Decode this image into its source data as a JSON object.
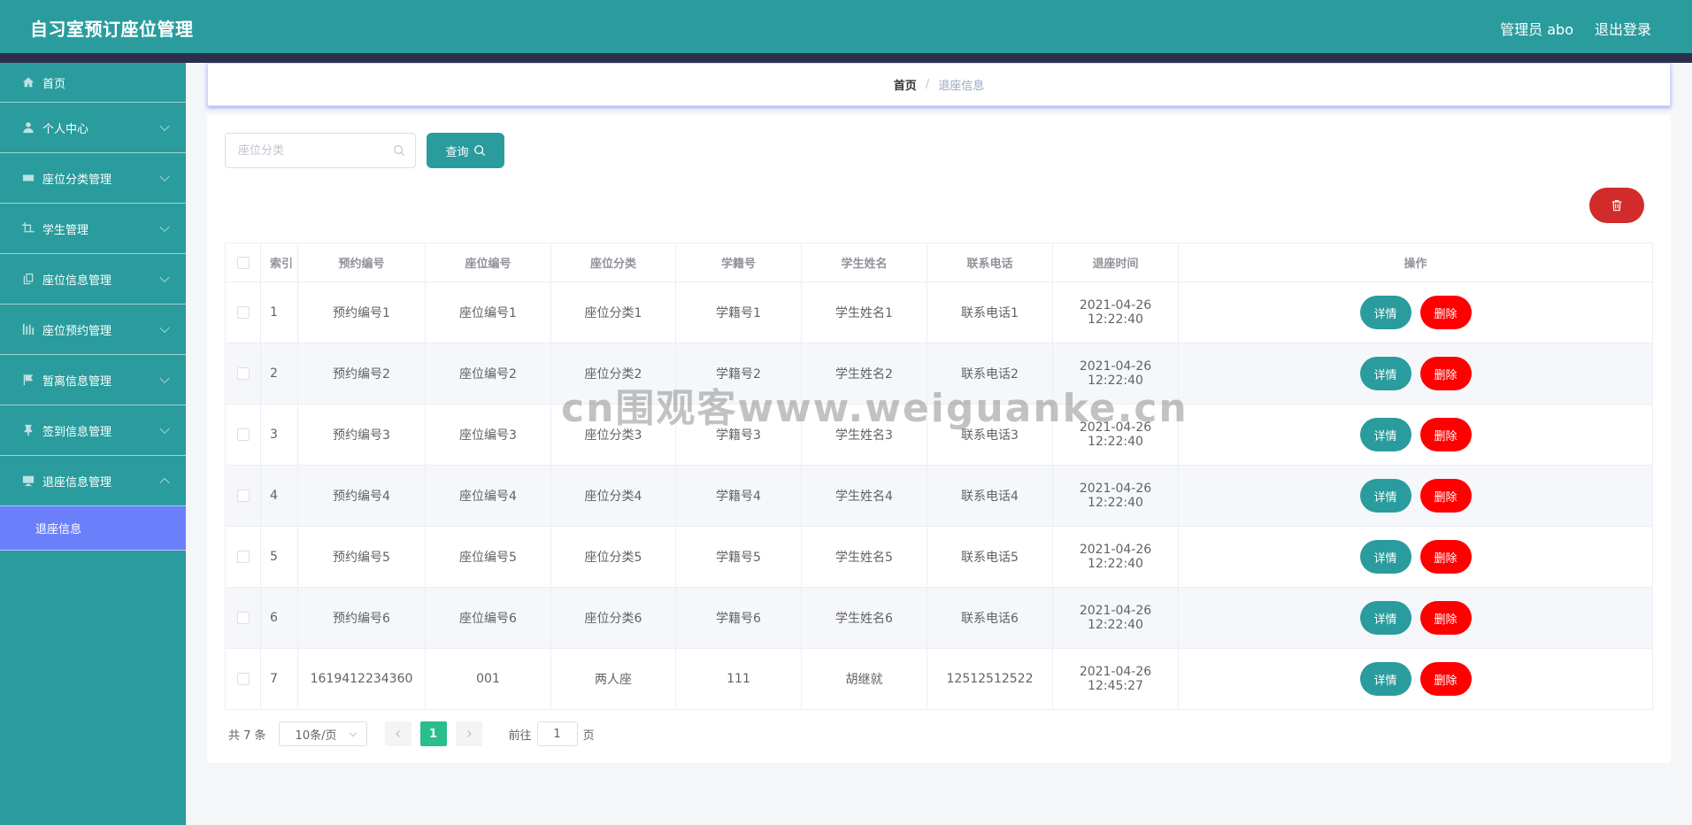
{
  "header": {
    "app_title": "自习室预订座位管理",
    "admin_label": "管理员 abo",
    "logout_label": "退出登录",
    "color": "#2a9c9d"
  },
  "sidebar": {
    "items": [
      {
        "label": "首页",
        "icon": "home-icon"
      },
      {
        "label": "个人中心",
        "icon": "user-icon"
      },
      {
        "label": "座位分类管理",
        "icon": "ticket-icon"
      },
      {
        "label": "学生管理",
        "icon": "crop-icon"
      },
      {
        "label": "座位信息管理",
        "icon": "copy-icon"
      },
      {
        "label": "座位预约管理",
        "icon": "chart-icon"
      },
      {
        "label": "暂离信息管理",
        "icon": "flag-icon"
      },
      {
        "label": "签到信息管理",
        "icon": "pushpin-icon"
      },
      {
        "label": "退座信息管理",
        "icon": "monitor-icon"
      }
    ],
    "active_sub": "退座信息",
    "active_color": "#6c7ffb"
  },
  "breadcrumb": {
    "home": "首页",
    "separator": "/",
    "current": "退座信息"
  },
  "search": {
    "placeholder": "座位分类",
    "query_label": "查询"
  },
  "table": {
    "columns": [
      "索引",
      "预约编号",
      "座位编号",
      "座位分类",
      "学籍号",
      "学生姓名",
      "联系电话",
      "退座时间",
      "操作"
    ],
    "rows": [
      [
        "1",
        "预约编号1",
        "座位编号1",
        "座位分类1",
        "学籍号1",
        "学生姓名1",
        "联系电话1",
        "2021-04-26 12:22:40"
      ],
      [
        "2",
        "预约编号2",
        "座位编号2",
        "座位分类2",
        "学籍号2",
        "学生姓名2",
        "联系电话2",
        "2021-04-26 12:22:40"
      ],
      [
        "3",
        "预约编号3",
        "座位编号3",
        "座位分类3",
        "学籍号3",
        "学生姓名3",
        "联系电话3",
        "2021-04-26 12:22:40"
      ],
      [
        "4",
        "预约编号4",
        "座位编号4",
        "座位分类4",
        "学籍号4",
        "学生姓名4",
        "联系电话4",
        "2021-04-26 12:22:40"
      ],
      [
        "5",
        "预约编号5",
        "座位编号5",
        "座位分类5",
        "学籍号5",
        "学生姓名5",
        "联系电话5",
        "2021-04-26 12:22:40"
      ],
      [
        "6",
        "预约编号6",
        "座位编号6",
        "座位分类6",
        "学籍号6",
        "学生姓名6",
        "联系电话6",
        "2021-04-26 12:22:40"
      ],
      [
        "7",
        "1619412234360",
        "001",
        "两人座",
        "111",
        "胡继就",
        "12512512522",
        "2021-04-26 12:45:27"
      ]
    ],
    "detail_label": "详情",
    "delete_label": "删除"
  },
  "pagination": {
    "total": "共 7 条",
    "page_size": "10条/页",
    "current_page": "1",
    "goto_prefix": "前往",
    "goto_value": "1",
    "goto_suffix": "页"
  },
  "watermark": "cn围观客www.weiguanke.cn"
}
